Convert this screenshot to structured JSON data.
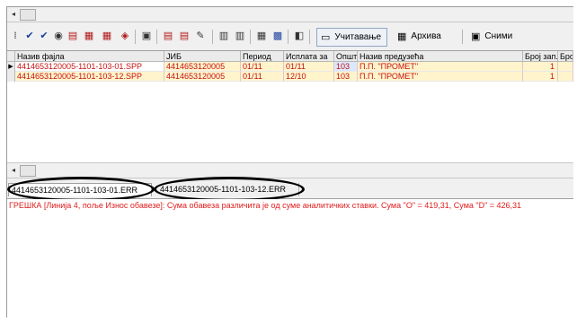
{
  "toolbar": {
    "left_icons": [
      {
        "name": "grip-icon"
      },
      {
        "name": "check-icon"
      },
      {
        "name": "double-check-icon"
      },
      {
        "name": "circle-icon"
      },
      {
        "name": "document-red-icon"
      },
      {
        "name": "document-red-2-icon"
      },
      {
        "name": "document-red-3-icon"
      },
      {
        "name": "document-red-4-icon"
      },
      {
        "name": "document-copy-icon"
      },
      {
        "name": "document-export-icon"
      },
      {
        "name": "document-import-icon"
      },
      {
        "name": "edit-icon"
      },
      {
        "name": "clipboard-icon"
      },
      {
        "name": "clipboard-2-icon"
      },
      {
        "name": "calc-icon"
      },
      {
        "name": "em-icon"
      },
      {
        "name": "folder-icon"
      }
    ],
    "buttons": {
      "load": {
        "label": "Учитавање",
        "icon": "folder-open-icon"
      },
      "archive": {
        "label": "Архива",
        "icon": "archive-icon"
      },
      "save": {
        "label": "Сними",
        "icon": "save-icon"
      }
    }
  },
  "table": {
    "columns": [
      "Назив фајла",
      "ЈИБ",
      "Период",
      "Исплата за",
      "Општ.",
      "Назив предузећа",
      "Број зап.",
      "Број"
    ],
    "rows": [
      {
        "file": "4414653120005-1101-103-01.SPP",
        "jib": "4414653120005",
        "period": "01/11",
        "payment": "01/11",
        "municipality": "103",
        "company": "П.П. \"ПРОМЕТ\"",
        "count": "1",
        "selected": true
      },
      {
        "file": "4414653120005-1101-103-12.SPP",
        "jib": "4414653120005",
        "period": "01/11",
        "payment": "12/10",
        "municipality": "103",
        "company": "П.П. \"ПРОМЕТ\"",
        "count": "1",
        "selected": false
      }
    ]
  },
  "error_tabs": [
    {
      "label": "4414653120005-1101-103-01.ERR",
      "active": true
    },
    {
      "label": "4414653120005-1101-103-12.ERR",
      "active": false
    }
  ],
  "error_message": "ГРЕШКА [Линија 4, поље Износ обавезе]: Сума обавеза различита је од суме аналитичких ставки. Сума \"O\" = 419,31, Сума \"D\" = 426,31",
  "colors": {
    "error_text": "#e01c1c",
    "row_text": "#c81010",
    "row_background": "#fff4cc",
    "annotation_ring": "#000000"
  }
}
